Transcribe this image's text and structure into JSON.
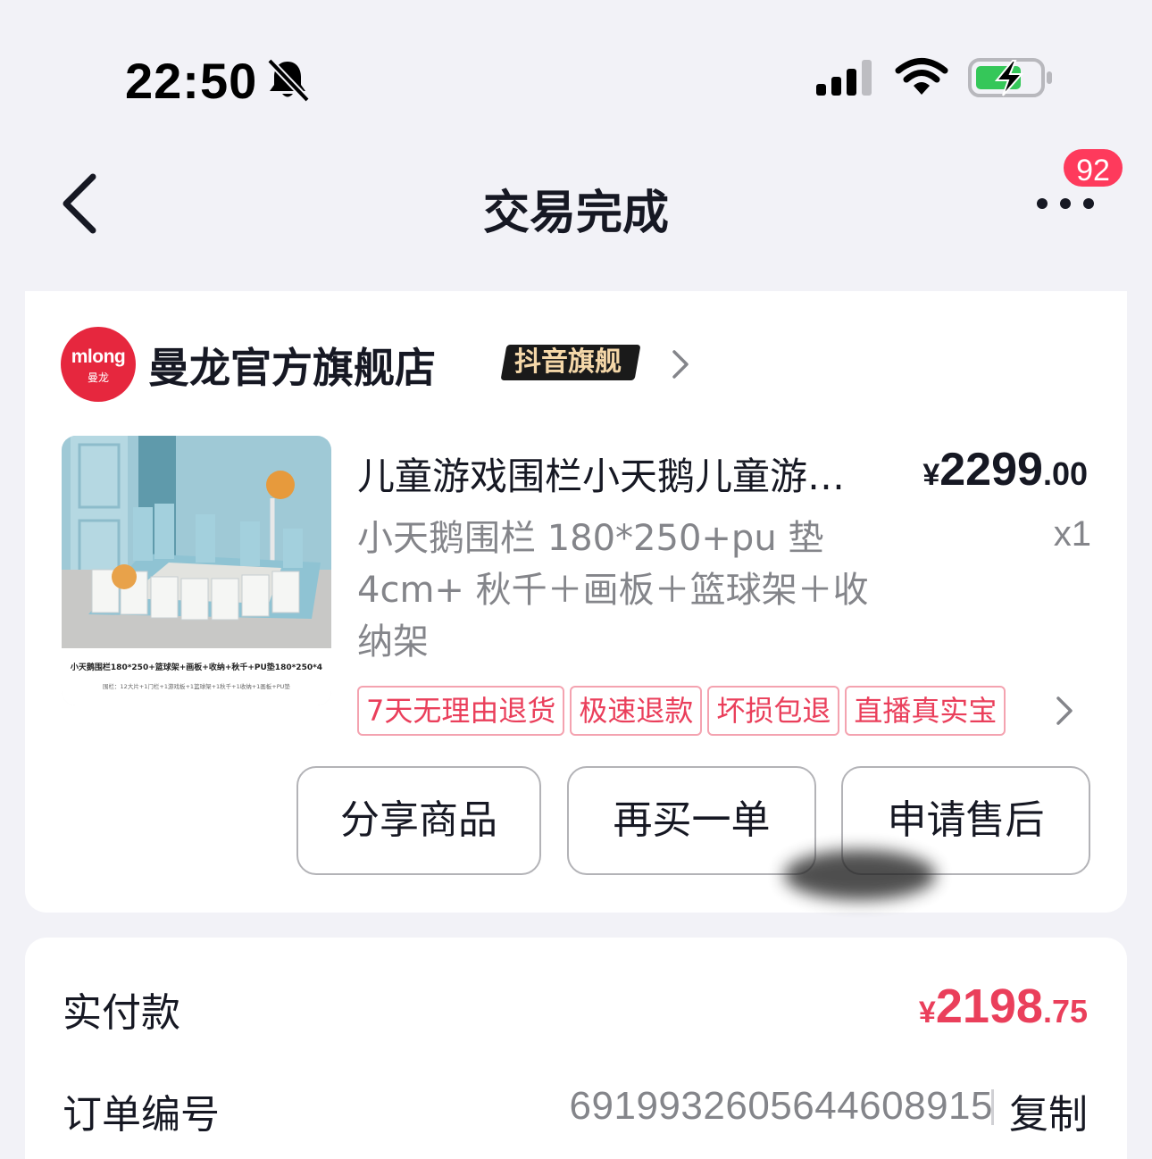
{
  "status_bar": {
    "time": "22:50",
    "icons": [
      "bell-off-icon",
      "signal-icon",
      "wifi-icon",
      "battery-charging-icon"
    ]
  },
  "nav": {
    "title": "交易完成",
    "back_icon": "back-chevron-icon",
    "more_icon": "more-dots-icon",
    "badge_count": "92"
  },
  "shop": {
    "logo_text": "mlong",
    "logo_sub": "曼龙",
    "name": "曼龙官方旗舰店",
    "badge": "抖音旗舰"
  },
  "product": {
    "title": "儿童游戏围栏小天鹅儿童游戏围栏宝宝防护栏",
    "price_symbol": "¥",
    "price_int": "2299",
    "price_dec": ".00",
    "spec": "小天鹅围栏 180*250+pu 垫 4cm+ 秋千＋画板＋篮球架＋收纳架",
    "quantity": "x1",
    "image_caption": "小天鹅围栏180*250+篮球架+画板+收纳+秋千+PU垫180*250*4",
    "image_subcaption": "围栏：12大片+1门栏+1游戏板+1篮球架+1秋千+1收纳+1画板+PU垫",
    "service_tags": [
      "7天无理由退货",
      "极速退款",
      "坏损包退",
      "直播真实宝"
    ]
  },
  "actions": {
    "share": "分享商品",
    "rebuy": "再买一单",
    "aftersale": "申请售后"
  },
  "payment": {
    "paid_label": "实付款",
    "paid_symbol": "¥",
    "paid_int": "2198",
    "paid_dec": ".75",
    "order_label": "订单编号",
    "order_number": "6919932605644608915",
    "copy_label": "复制"
  },
  "colors": {
    "accent_red": "#ea3f5b",
    "badge_red": "#fe3a5c",
    "text_primary": "#161823",
    "text_secondary": "#84858a",
    "background": "#f2f2f7"
  }
}
